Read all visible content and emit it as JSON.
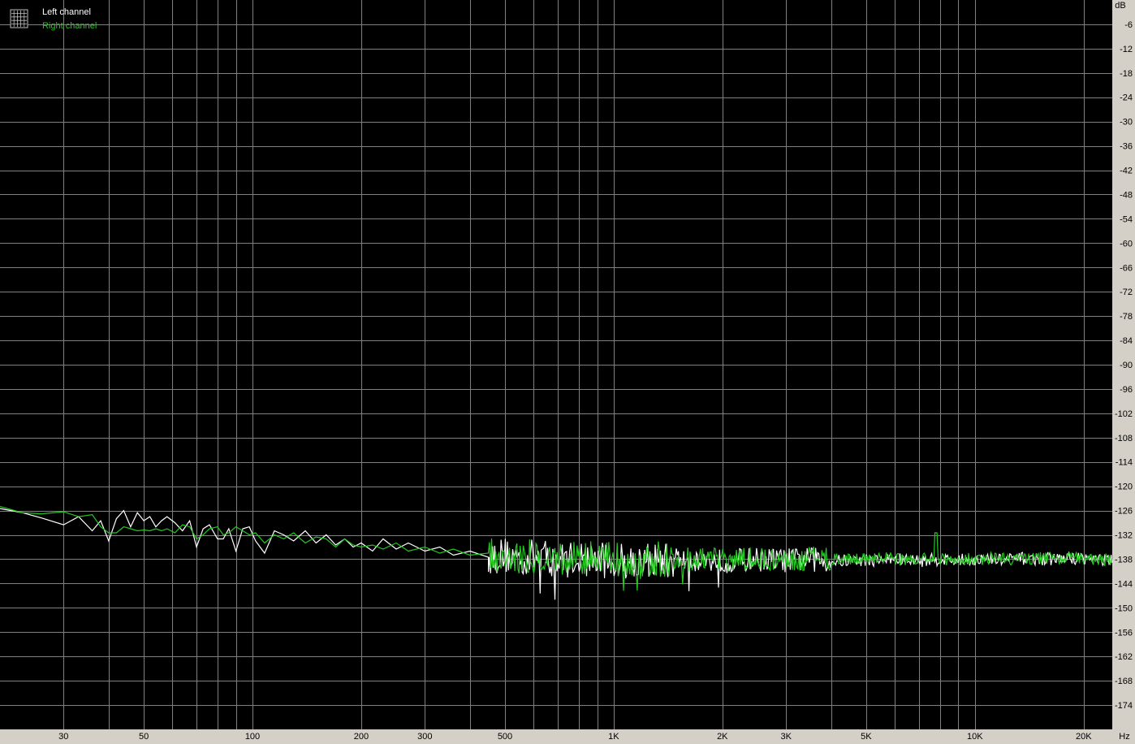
{
  "chart_data": {
    "type": "line",
    "title": "",
    "xlabel": "",
    "ylabel": "",
    "x_unit": "Hz",
    "y_unit": "dB",
    "x_scale": "log",
    "xlim": [
      20,
      24000
    ],
    "ylim": [
      -180,
      0
    ],
    "grid": true,
    "background": "#000000",
    "grid_color": "#808080",
    "legend_position": "top-left",
    "x_ticks": [
      {
        "value": 30,
        "label": "30"
      },
      {
        "value": 50,
        "label": "50"
      },
      {
        "value": 100,
        "label": "100"
      },
      {
        "value": 200,
        "label": "200"
      },
      {
        "value": 300,
        "label": "300"
      },
      {
        "value": 500,
        "label": "500"
      },
      {
        "value": 1000,
        "label": "1K"
      },
      {
        "value": 2000,
        "label": "2K"
      },
      {
        "value": 3000,
        "label": "3K"
      },
      {
        "value": 5000,
        "label": "5K"
      },
      {
        "value": 10000,
        "label": "10K"
      },
      {
        "value": 20000,
        "label": "20K"
      }
    ],
    "y_ticks": [
      -6,
      -12,
      -18,
      -24,
      -30,
      -36,
      -42,
      -48,
      -54,
      -60,
      -66,
      -72,
      -78,
      -84,
      -90,
      -96,
      -102,
      -108,
      -114,
      -120,
      -126,
      -132,
      -138,
      -144,
      -150,
      -156,
      -162,
      -168,
      -174
    ],
    "series": [
      {
        "name": "Left channel",
        "color": "#ffffff",
        "points": [
          [
            20,
            -125.5
          ],
          [
            23,
            -126.5
          ],
          [
            26,
            -127.8
          ],
          [
            30,
            -129.5
          ],
          [
            33,
            -127.5
          ],
          [
            36,
            -131
          ],
          [
            38,
            -128.5
          ],
          [
            40,
            -133.5
          ],
          [
            42,
            -128
          ],
          [
            44,
            -126
          ],
          [
            46,
            -130
          ],
          [
            48,
            -126.5
          ],
          [
            50,
            -128.5
          ],
          [
            52,
            -127.5
          ],
          [
            54,
            -130
          ],
          [
            56,
            -128.5
          ],
          [
            58,
            -127.5
          ],
          [
            61,
            -129
          ],
          [
            64,
            -131
          ],
          [
            67,
            -128.5
          ],
          [
            70,
            -135
          ],
          [
            73,
            -130.5
          ],
          [
            76,
            -129.5
          ],
          [
            80,
            -133
          ],
          [
            83,
            -133
          ],
          [
            86,
            -130.5
          ],
          [
            90,
            -136
          ],
          [
            94,
            -130.5
          ],
          [
            98,
            -130
          ],
          [
            102,
            -133.5
          ],
          [
            108,
            -136.5
          ],
          [
            115,
            -131
          ],
          [
            122,
            -132
          ],
          [
            130,
            -133.5
          ],
          [
            140,
            -131
          ],
          [
            150,
            -134
          ],
          [
            160,
            -132
          ],
          [
            170,
            -134.5
          ],
          [
            180,
            -133
          ],
          [
            190,
            -135
          ],
          [
            200,
            -134
          ],
          [
            215,
            -136
          ],
          [
            230,
            -133
          ],
          [
            250,
            -135.5
          ],
          [
            270,
            -134
          ],
          [
            300,
            -136
          ],
          [
            330,
            -135
          ],
          [
            360,
            -137
          ],
          [
            400,
            -136
          ],
          [
            450,
            -137.5
          ],
          [
            500,
            -137
          ],
          [
            560,
            -138
          ],
          [
            630,
            -137
          ],
          [
            700,
            -138.5
          ],
          [
            800,
            -137.5
          ],
          [
            900,
            -138
          ],
          [
            1000,
            -138.5
          ],
          [
            1200,
            -138
          ],
          [
            1400,
            -138.5
          ],
          [
            1700,
            -138
          ],
          [
            2000,
            -138.5
          ],
          [
            2500,
            -138
          ],
          [
            3000,
            -138.3
          ],
          [
            3500,
            -138
          ],
          [
            4000,
            -138.5
          ],
          [
            5000,
            -138.2
          ],
          [
            6000,
            -138
          ],
          [
            7000,
            -138.4
          ],
          [
            8000,
            -138
          ],
          [
            9000,
            -138.3
          ],
          [
            10000,
            -138
          ],
          [
            12000,
            -138.2
          ],
          [
            14000,
            -137.8
          ],
          [
            16000,
            -138
          ],
          [
            18000,
            -137.8
          ],
          [
            20000,
            -137.7
          ],
          [
            22000,
            -138
          ],
          [
            24000,
            -138.5
          ]
        ]
      },
      {
        "name": "Right channel",
        "color": "#22c91e",
        "points": [
          [
            20,
            -125
          ],
          [
            23,
            -126.5
          ],
          [
            26,
            -126.8
          ],
          [
            30,
            -126.3
          ],
          [
            33,
            -127.5
          ],
          [
            36,
            -127
          ],
          [
            38,
            -130
          ],
          [
            40,
            -131.5
          ],
          [
            42,
            -131.5
          ],
          [
            44,
            -130
          ],
          [
            46,
            -130.5
          ],
          [
            48,
            -131
          ],
          [
            50,
            -130.8
          ],
          [
            52,
            -131
          ],
          [
            54,
            -130.5
          ],
          [
            56,
            -131
          ],
          [
            58,
            -130.5
          ],
          [
            61,
            -131.5
          ],
          [
            64,
            -129.5
          ],
          [
            67,
            -130
          ],
          [
            70,
            -133
          ],
          [
            73,
            -132
          ],
          [
            76,
            -130.5
          ],
          [
            80,
            -130
          ],
          [
            83,
            -132
          ],
          [
            86,
            -131.5
          ],
          [
            90,
            -130
          ],
          [
            94,
            -131
          ],
          [
            98,
            -132
          ],
          [
            102,
            -131.5
          ],
          [
            108,
            -134
          ],
          [
            115,
            -132
          ],
          [
            122,
            -133
          ],
          [
            130,
            -131.5
          ],
          [
            140,
            -134
          ],
          [
            150,
            -132.5
          ],
          [
            160,
            -133
          ],
          [
            170,
            -135
          ],
          [
            180,
            -133
          ],
          [
            190,
            -134.5
          ],
          [
            200,
            -135
          ],
          [
            215,
            -134.5
          ],
          [
            230,
            -135.5
          ],
          [
            250,
            -134
          ],
          [
            270,
            -136
          ],
          [
            300,
            -135
          ],
          [
            330,
            -136.5
          ],
          [
            360,
            -135.5
          ],
          [
            400,
            -137
          ],
          [
            450,
            -136.5
          ],
          [
            500,
            -137
          ],
          [
            560,
            -137.5
          ],
          [
            630,
            -137
          ],
          [
            700,
            -138
          ],
          [
            800,
            -137.5
          ],
          [
            900,
            -138
          ],
          [
            1000,
            -138
          ],
          [
            1200,
            -137.8
          ],
          [
            1400,
            -138.2
          ],
          [
            1700,
            -137.8
          ],
          [
            2000,
            -138.2
          ],
          [
            2500,
            -138
          ],
          [
            3000,
            -138
          ],
          [
            3500,
            -137.8
          ],
          [
            4000,
            -138.2
          ],
          [
            5000,
            -138
          ],
          [
            6000,
            -137.8
          ],
          [
            7000,
            -138.1
          ],
          [
            7750,
            -138
          ],
          [
            7800,
            -131.5
          ],
          [
            7850,
            -138
          ],
          [
            8500,
            -138
          ],
          [
            9000,
            -138.1
          ],
          [
            10000,
            -137.8
          ],
          [
            12000,
            -138
          ],
          [
            14000,
            -137.7
          ],
          [
            16000,
            -137.9
          ],
          [
            18000,
            -137.6
          ],
          [
            20000,
            -137.7
          ],
          [
            22000,
            -138
          ],
          [
            24000,
            -138.3
          ]
        ]
      }
    ],
    "annotations": {
      "y_unit_label": "dB",
      "x_unit_label": "Hz"
    }
  }
}
